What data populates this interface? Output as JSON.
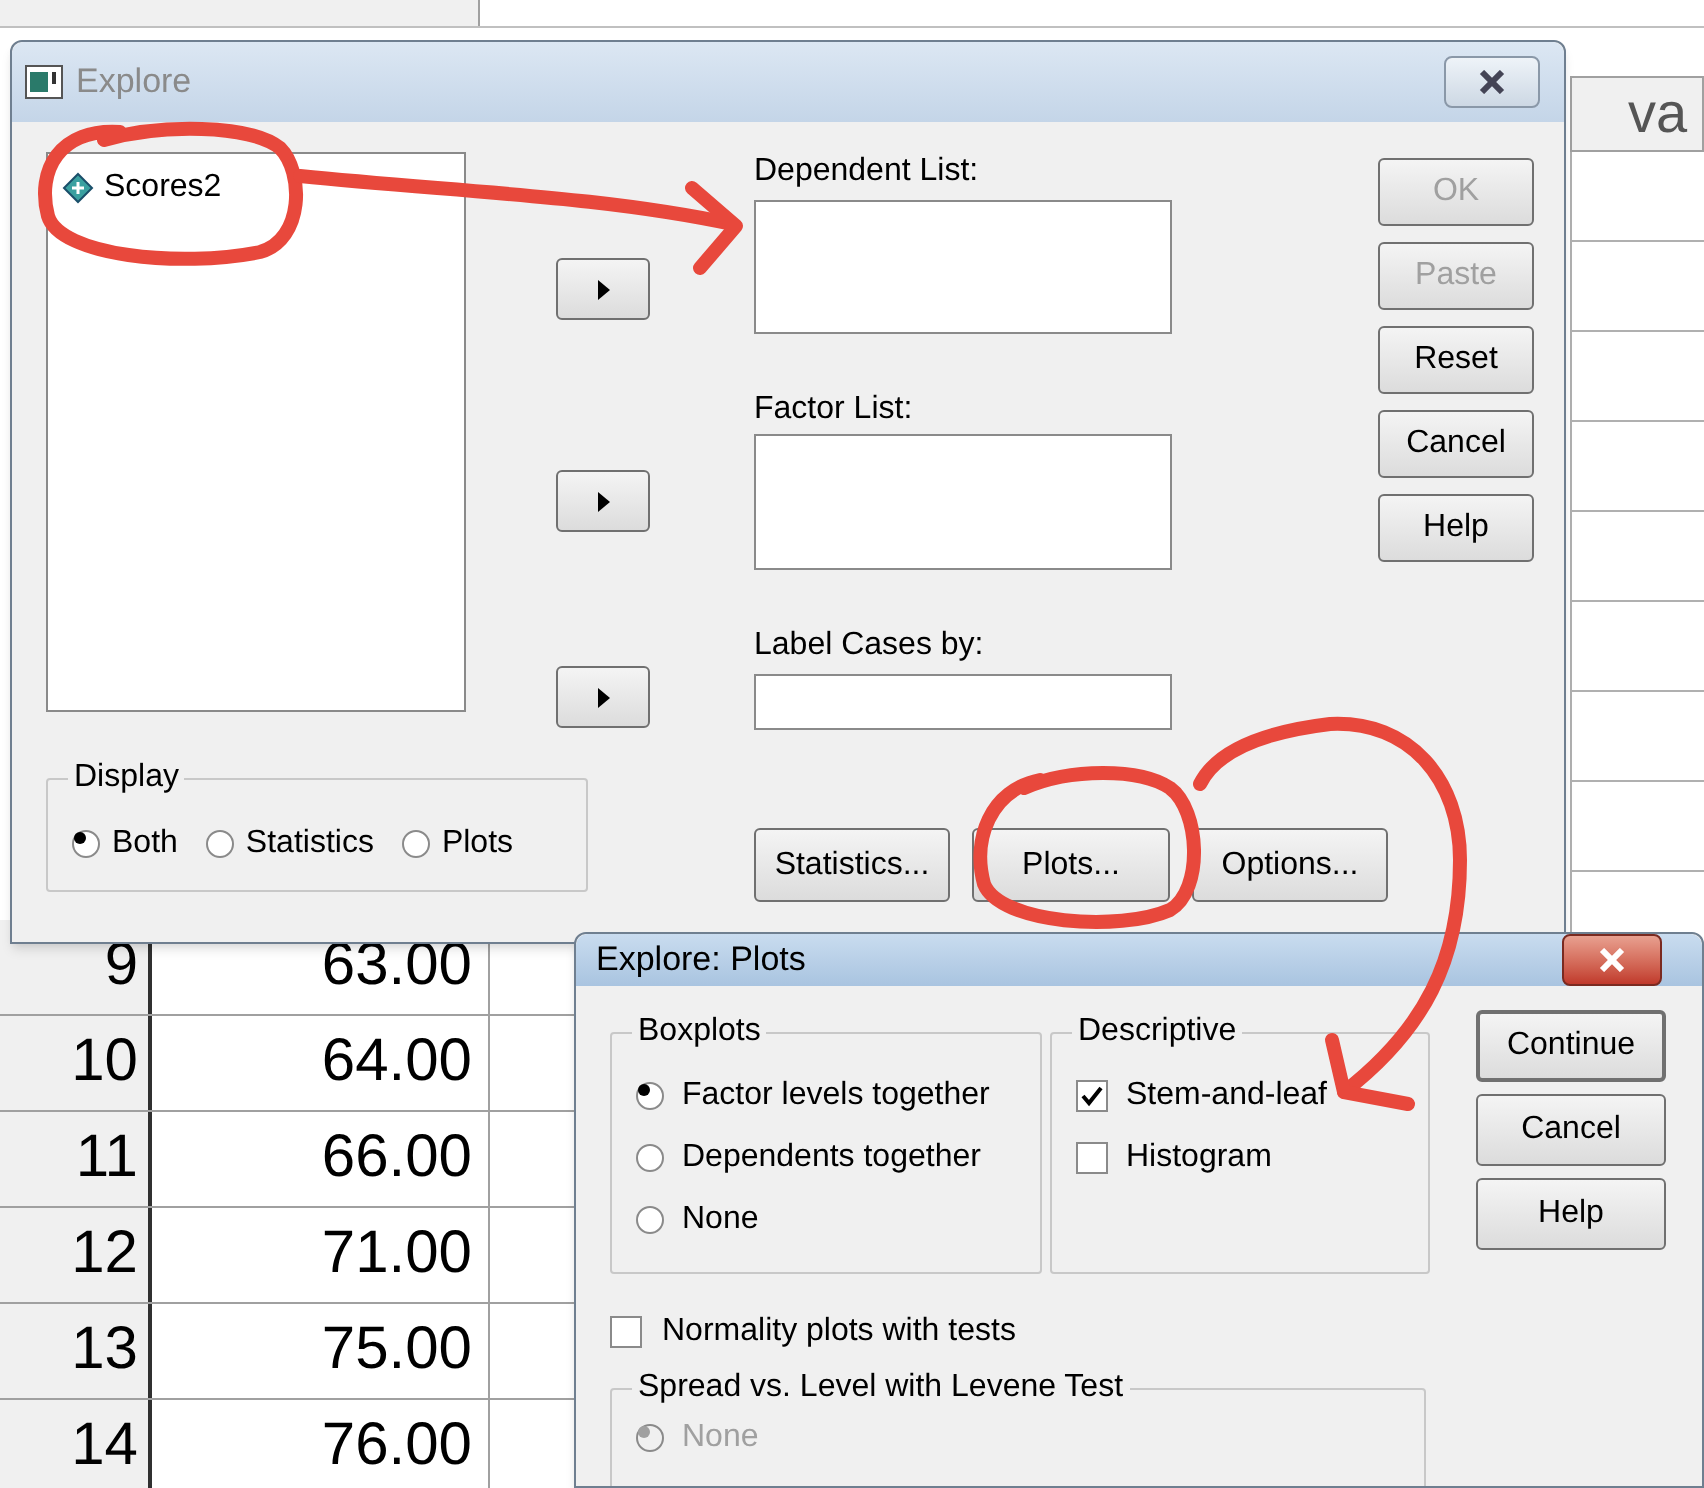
{
  "data_view": {
    "column_header": "va",
    "rows": [
      {
        "number": "9",
        "value": "63.00"
      },
      {
        "number": "10",
        "value": "64.00"
      },
      {
        "number": "11",
        "value": "66.00"
      },
      {
        "number": "12",
        "value": "71.00"
      },
      {
        "number": "13",
        "value": "75.00"
      },
      {
        "number": "14",
        "value": "76.00"
      }
    ]
  },
  "explore": {
    "title": "Explore",
    "variables": [
      "Scores2"
    ],
    "dependent_list_label": "Dependent List:",
    "factor_list_label": "Factor List:",
    "label_cases_label": "Label Cases by:",
    "side_buttons": [
      {
        "label": "OK",
        "disabled": true
      },
      {
        "label": "Paste",
        "disabled": true
      },
      {
        "label": "Reset",
        "disabled": false
      },
      {
        "label": "Cancel",
        "disabled": false
      },
      {
        "label": "Help",
        "disabled": false
      }
    ],
    "display": {
      "title": "Display",
      "options": [
        {
          "label": "Both",
          "selected": true
        },
        {
          "label": "Statistics",
          "selected": false
        },
        {
          "label": "Plots",
          "selected": false
        }
      ]
    },
    "bottom_buttons": [
      "Statistics...",
      "Plots...",
      "Options..."
    ]
  },
  "plots": {
    "title": "Explore: Plots",
    "boxplots": {
      "title": "Boxplots",
      "options": [
        {
          "label": "Factor levels together",
          "selected": true
        },
        {
          "label": "Dependents together",
          "selected": false
        },
        {
          "label": "None",
          "selected": false
        }
      ]
    },
    "descriptive": {
      "title": "Descriptive",
      "options": [
        {
          "label": "Stem-and-leaf",
          "checked": true
        },
        {
          "label": "Histogram",
          "checked": false
        }
      ]
    },
    "buttons": [
      {
        "label": "Continue",
        "default": true
      },
      {
        "label": "Cancel",
        "default": false
      },
      {
        "label": "Help",
        "default": false
      }
    ],
    "normality": {
      "label": "Normality plots with tests",
      "checked": false
    },
    "spread": {
      "title": "Spread vs. Level with Levene Test",
      "options": [
        {
          "label": "None",
          "selected": true,
          "disabled": true
        }
      ]
    }
  }
}
